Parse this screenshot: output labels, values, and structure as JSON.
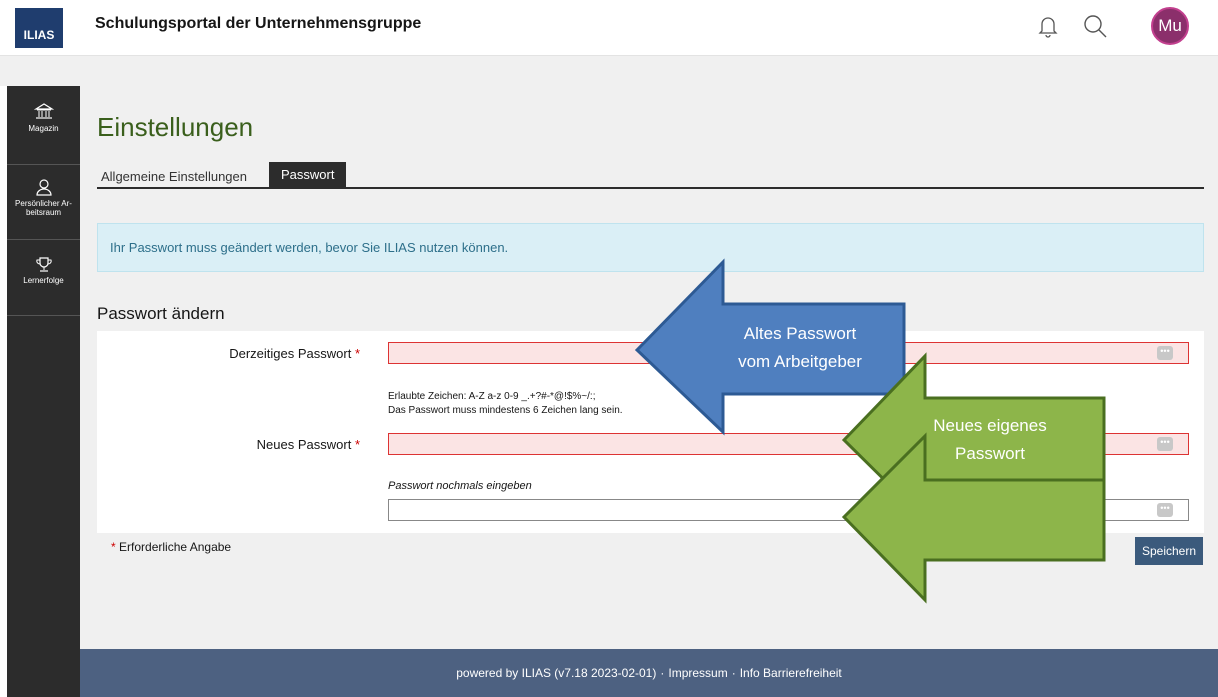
{
  "header": {
    "logo_text": "ILIAS",
    "portal_title": "Schulungsportal der Unternehmensgruppe",
    "avatar_initials": "Mu",
    "icons": [
      "bell-icon",
      "search-icon"
    ]
  },
  "sidebar": {
    "items": [
      {
        "label": "Magazin",
        "icon": "library-icon"
      },
      {
        "label": "Persönlicher Ar-beitsraum",
        "icon": "user-icon"
      },
      {
        "label": "Lernerfolge",
        "icon": "trophy-icon"
      }
    ]
  },
  "page": {
    "title": "Einstellungen",
    "tabs": [
      {
        "label": "Allgemeine Einstellungen",
        "active": false
      },
      {
        "label": "Passwort",
        "active": true
      }
    ],
    "info_message": "Ihr Passwort muss geändert werden, bevor Sie ILIAS nutzen können.",
    "section_title": "Passwort ändern"
  },
  "form": {
    "current_password_label": "Derzeitiges Passwort",
    "new_password_label": "Neues Passwort",
    "required_marker": "*",
    "hint_chars": "Erlaubte Zeichen: A-Z a-z 0-9 _.+?#-*@!$%~/:;",
    "hint_length": "Das Passwort muss mindestens 6 Zeichen lang sein.",
    "repeat_label": "Passwort nochmals eingeben",
    "reveal_glyph": "•••",
    "required_note": "Erforderliche Angabe",
    "save_label": "Speichern"
  },
  "footer": {
    "powered_by": "powered by ILIAS (v7.18 2023-02-01)",
    "separator": "·",
    "impressum": "Impressum",
    "accessibility": "Info Barrierefreiheit"
  },
  "annotations": {
    "blue_arrow_line1": "Altes Passwort",
    "blue_arrow_line2": "vom Arbeitgeber",
    "green_arrow_line1": "Neues eigenes",
    "green_arrow_line2": "Passwort",
    "colors": {
      "blue": "#4f7fbf",
      "green": "#8db54a",
      "border": "#4a6f20"
    }
  }
}
